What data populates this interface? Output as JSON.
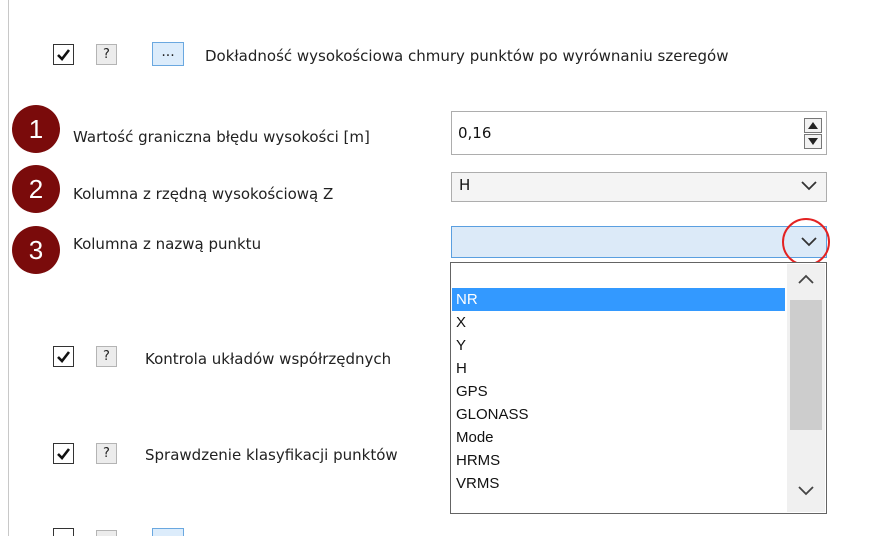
{
  "top_row": {
    "question": "?",
    "dots": "...",
    "label": "Dokładność wysokościowa chmury punktów po wyrównaniu szeregów"
  },
  "param1": {
    "badge": "1",
    "label": "Wartość graniczna błędu wysokości [m]",
    "value": "0,16"
  },
  "param2": {
    "badge": "2",
    "label": "Kolumna z rzędną wysokościową Z",
    "value": "H"
  },
  "param3": {
    "badge": "3",
    "label": "Kolumna z nazwą punktu",
    "value": ""
  },
  "dropdown": {
    "blank": "",
    "options": [
      "NR",
      "X",
      "Y",
      "H",
      "GPS",
      "GLONASS",
      "Mode",
      "HRMS",
      "VRMS"
    ],
    "selected": "NR"
  },
  "row_coords": {
    "question": "?",
    "label": "Kontrola układów współrzędnych"
  },
  "row_class": {
    "question": "?",
    "label": "Sprawdzenie klasyfikacji punktów"
  },
  "icons": {
    "checkmark": "check-icon",
    "spin_up": "triangle-up-icon",
    "spin_down": "triangle-down-icon",
    "chevron": "chevron-down-icon"
  },
  "colors": {
    "badge": "#7a0b0b",
    "highlight_circle": "#e32222",
    "selection": "#3399ff"
  }
}
